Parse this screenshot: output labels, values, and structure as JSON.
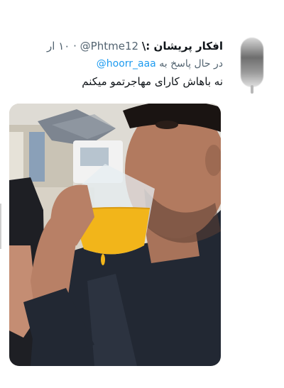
{
  "tweet": {
    "display_name": "افکار پریشان :\\",
    "handle": "@Phtme12",
    "time": "۱۰ ار",
    "replying_to_prefix": "در حال پاسخ به",
    "replying_to_handle": "@hoorr_aaa",
    "text": "نه باهاش کارای مهاجرتمو میکنم"
  },
  "media": {
    "description_icon": "photo-icon"
  },
  "colors": {
    "accent": "#1d9bf0",
    "text": "#0f1419",
    "muted": "#536471"
  }
}
